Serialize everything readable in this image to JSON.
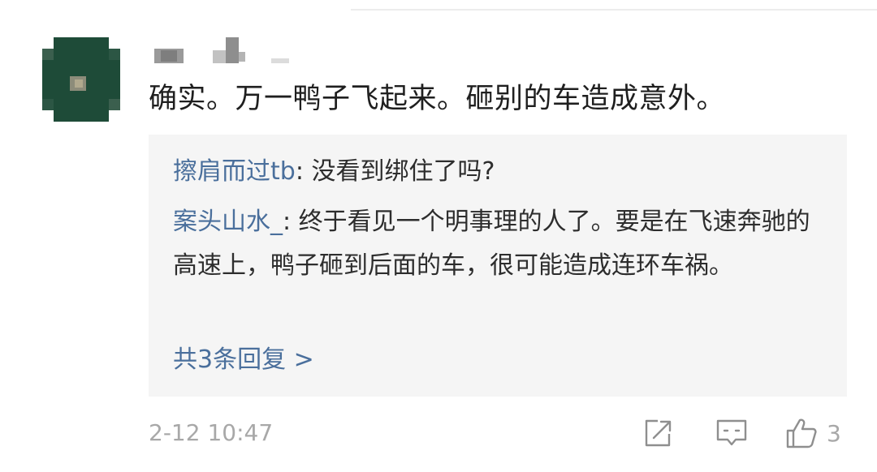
{
  "comment": {
    "text": "确实。万一鸭子飞起来。砸别的车造成意外。",
    "timestamp": "2-12 10:47",
    "like_count": "3"
  },
  "replies": [
    {
      "author": "擦肩而过tb",
      "separator": ": ",
      "text": "没看到绑住了吗?"
    },
    {
      "author": "案头山水_",
      "separator": ": ",
      "text": "终于看见一个明事理的人了。要是在飞速奔驰的高速上，鸭子砸到后面的车，很可能造成连环车祸。"
    }
  ],
  "more_replies_label": "共3条回复 >",
  "colors": {
    "link_blue": "#4a6f9c",
    "reply_bg": "#f5f5f5",
    "meta_gray": "#a8a8a8",
    "avatar_green": "#1e4b38"
  },
  "icons": {
    "share": "share-icon",
    "comment": "comment-icon",
    "like": "thumbs-up-icon"
  }
}
